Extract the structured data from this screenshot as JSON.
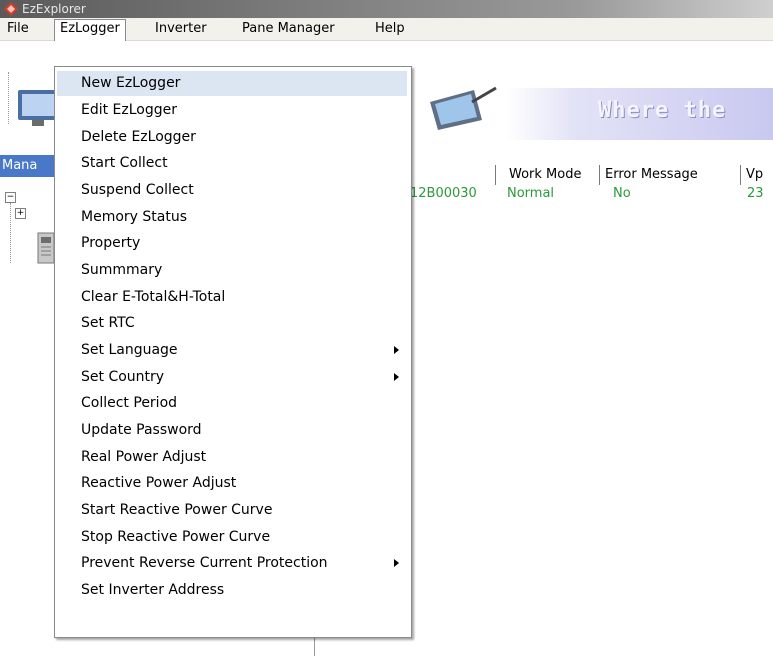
{
  "window": {
    "title": "EzExplorer"
  },
  "menubar": {
    "items": [
      "File",
      "EzLogger",
      "Inverter",
      "Pane Manager",
      "Help"
    ]
  },
  "banner": {
    "text": "Where the"
  },
  "leftpane": {
    "header": "Mana"
  },
  "table": {
    "columns": [
      "Work Mode",
      "Error Message",
      "Vp"
    ],
    "row": {
      "serial": "12B00030",
      "work_mode": "Normal",
      "error_message": "No",
      "vp": "23"
    }
  },
  "dropdown": {
    "items": [
      {
        "label": "New EzLogger",
        "submenu": false
      },
      {
        "label": "Edit EzLogger",
        "submenu": false
      },
      {
        "label": "Delete EzLogger",
        "submenu": false
      },
      {
        "label": "Start Collect",
        "submenu": false
      },
      {
        "label": "Suspend Collect",
        "submenu": false
      },
      {
        "label": "Memory Status",
        "submenu": false
      },
      {
        "label": "Property",
        "submenu": false
      },
      {
        "label": "Summmary",
        "submenu": false
      },
      {
        "label": "Clear E-Total&H-Total",
        "submenu": false
      },
      {
        "label": "Set RTC",
        "submenu": false
      },
      {
        "label": "Set Language",
        "submenu": true
      },
      {
        "label": "Set Country",
        "submenu": true
      },
      {
        "label": "Collect Period",
        "submenu": false
      },
      {
        "label": "Update Password",
        "submenu": false
      },
      {
        "label": "Real Power Adjust",
        "submenu": false
      },
      {
        "label": "Reactive Power Adjust",
        "submenu": false
      },
      {
        "label": "Start Reactive Power Curve",
        "submenu": false
      },
      {
        "label": "Stop Reactive Power Curve",
        "submenu": false
      },
      {
        "label": "Prevent Reverse Current Protection",
        "submenu": true
      },
      {
        "label": "Set Inverter Address",
        "submenu": false
      }
    ]
  },
  "colors": {
    "accent": "#4a78c8",
    "highlight": "#dce6f2",
    "status_green": "#2b9a3a"
  }
}
